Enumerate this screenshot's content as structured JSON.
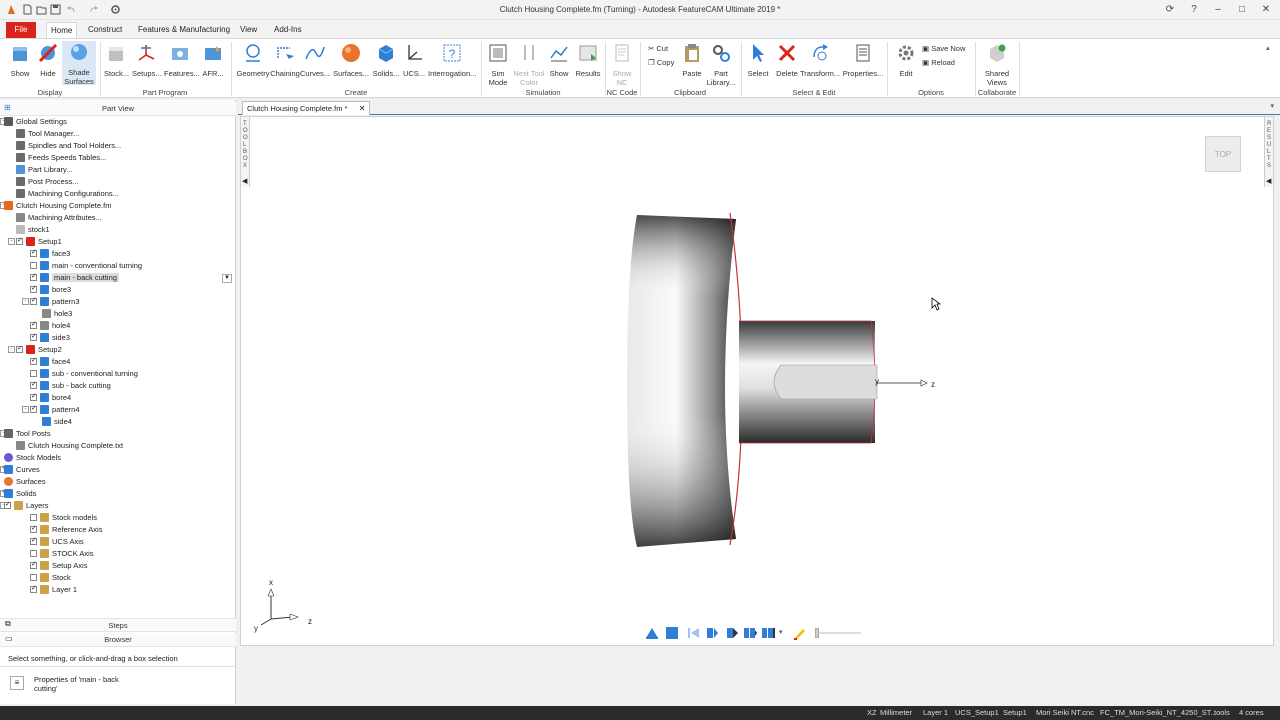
{
  "window": {
    "title": "Clutch Housing Complete.fm (Turning) - Autodesk FeatureCAM Ultimate 2019 *"
  },
  "tabs": [
    "File",
    "Home",
    "Construct",
    "Features & Manufacturing",
    "View",
    "Add-Ins"
  ],
  "ribbon": {
    "display": {
      "show": "Show",
      "hide": "Hide",
      "shade": "Shade Surfaces",
      "group": "Display"
    },
    "part_program": {
      "stock": "Stock...",
      "setups": "Setups...",
      "features": "Features...",
      "afr": "AFR...",
      "group": "Part Program"
    },
    "create": {
      "geometry": "Geometry",
      "chaining": "Chaining",
      "curves": "Curves...",
      "surfaces": "Surfaces...",
      "solids": "Solids...",
      "ucs": "UCS...",
      "interrogation": "Interrogation...",
      "group": "Create"
    },
    "simulation": {
      "sim_mode": "Sim Mode",
      "next_tool_color": "Next Tool Color",
      "show": "Show",
      "results": "Results",
      "group": "Simulation"
    },
    "nc_code": {
      "show_nc": "Show NC",
      "group": "NC Code"
    },
    "clipboard": {
      "cut": "Cut",
      "copy": "Copy",
      "paste": "Paste",
      "part_library": "Part Library...",
      "group": "Clipboard"
    },
    "select_edit": {
      "select": "Select",
      "delete": "Delete",
      "transform": "Transform...",
      "properties": "Properties...",
      "group": "Select & Edit"
    },
    "options": {
      "edit": "Edit",
      "save_now": "Save Now",
      "reload": "Reload",
      "group": "Options"
    },
    "collaborate": {
      "shared_views": "Shared Views",
      "group": "Collaborate"
    }
  },
  "left_panel": {
    "header": "Part View",
    "steps": "Steps",
    "browser": "Browser",
    "hint": "Select something, or click-and-drag a box selection",
    "properties_line1": "Properties of 'main - back",
    "properties_line2": "cutting'",
    "tree": [
      {
        "label": "Global Settings"
      },
      {
        "label": "Tool Manager..."
      },
      {
        "label": "Spindles and Tool Holders..."
      },
      {
        "label": "Feeds  Speeds Tables..."
      },
      {
        "label": "Part Library..."
      },
      {
        "label": "Post Process..."
      },
      {
        "label": "Machining Configurations..."
      },
      {
        "label": "Clutch Housing Complete.fm"
      },
      {
        "label": "Machining Attributes..."
      },
      {
        "label": "stock1"
      },
      {
        "label": "Setup1"
      },
      {
        "label": "face3"
      },
      {
        "label": "main - conventional turning"
      },
      {
        "label": "main - back cutting"
      },
      {
        "label": "bore3"
      },
      {
        "label": "pattern3"
      },
      {
        "label": "hole3"
      },
      {
        "label": "hole4"
      },
      {
        "label": "side3"
      },
      {
        "label": "Setup2"
      },
      {
        "label": "face4"
      },
      {
        "label": "sub - conventional turning"
      },
      {
        "label": "sub - back cutting"
      },
      {
        "label": "bore4"
      },
      {
        "label": "pattern4"
      },
      {
        "label": "side4"
      },
      {
        "label": "Tool Posts"
      },
      {
        "label": "Clutch Housing Complete.txt"
      },
      {
        "label": "Stock Models"
      },
      {
        "label": "Curves"
      },
      {
        "label": "Surfaces"
      },
      {
        "label": "Solids"
      },
      {
        "label": "Layers"
      },
      {
        "label": "Stock models"
      },
      {
        "label": "Reference Axis"
      },
      {
        "label": "UCS Axis"
      },
      {
        "label": "STOCK Axis"
      },
      {
        "label": "Setup Axis"
      },
      {
        "label": "Stock"
      },
      {
        "label": "Layer 1"
      }
    ]
  },
  "document": {
    "tab": "Clutch Housing Complete.fm *",
    "toolbox_label": "TOOLBOX",
    "results_label": "RESULTS",
    "view_cube": "TOP",
    "axis_x": "x",
    "axis_y": "y",
    "axis_z": "z",
    "part_axis_y": "y",
    "part_axis_z": "z"
  },
  "status": {
    "plane": "XZ",
    "units": "Millimeter",
    "layer": "Layer 1",
    "ucs": "UCS_Setup1",
    "setup": "Setup1",
    "post": "Mori Seiki NT.cnc",
    "machine": "FC_TM_Mori-Seiki_NT_4250_ST...",
    "tools": "tools",
    "cores": "4 cores"
  },
  "colors": {
    "file_tab": "#d9241c",
    "accent_blue": "#2f7fd6",
    "status_bar": "#2b2b2b"
  }
}
